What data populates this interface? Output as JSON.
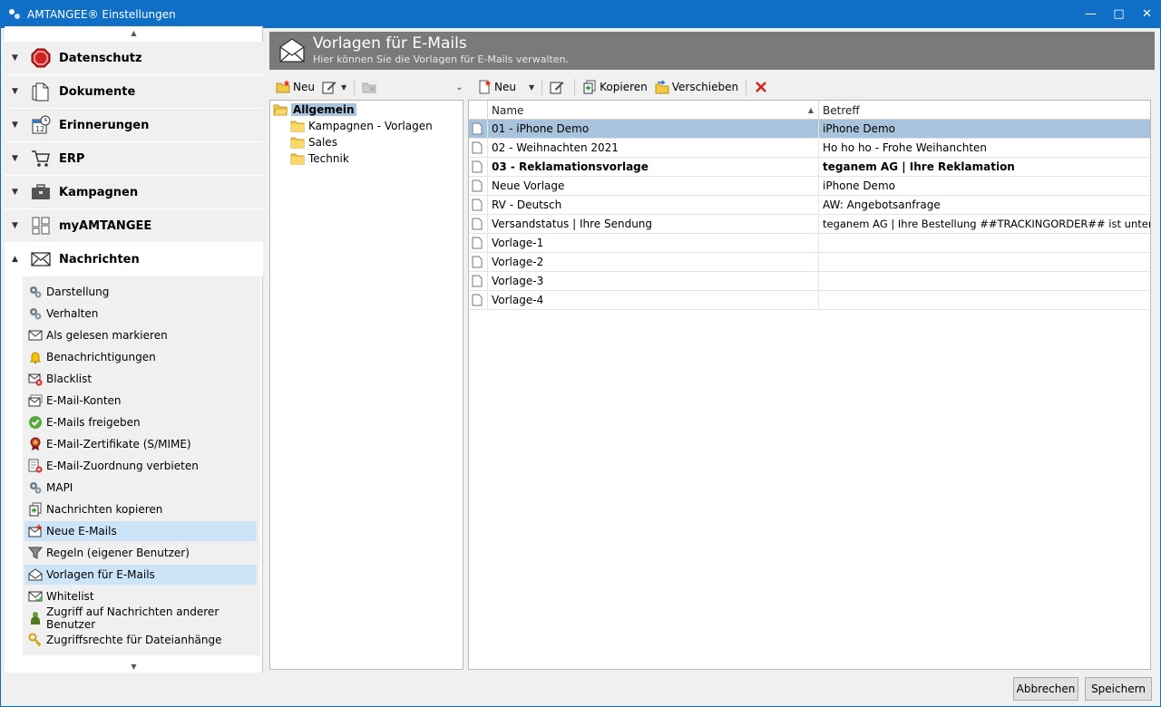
{
  "window": {
    "title": "AMTANGEE® Einstellungen"
  },
  "sidebar": {
    "categories": [
      {
        "label": "Datenschutz",
        "icon": "stop-sign-icon"
      },
      {
        "label": "Dokumente",
        "icon": "document-icon"
      },
      {
        "label": "Erinnerungen",
        "icon": "calendar-clock-icon"
      },
      {
        "label": "ERP",
        "icon": "cart-icon"
      },
      {
        "label": "Kampagnen",
        "icon": "briefcase-icon"
      },
      {
        "label": "myAMTANGEE",
        "icon": "grid-icon"
      },
      {
        "label": "Nachrichten",
        "icon": "envelope-icon"
      }
    ],
    "sub_items": [
      {
        "label": "Darstellung",
        "icon": "gears-icon"
      },
      {
        "label": "Verhalten",
        "icon": "gears-icon"
      },
      {
        "label": "Als gelesen markieren",
        "icon": "envelope-icon"
      },
      {
        "label": "Benachrichtigungen",
        "icon": "bell-icon"
      },
      {
        "label": "Blacklist",
        "icon": "envelope-blocked-icon"
      },
      {
        "label": "E-Mail-Konten",
        "icon": "envelope-accounts-icon"
      },
      {
        "label": "E-Mails freigeben",
        "icon": "checkmark-icon"
      },
      {
        "label": "E-Mail-Zertifikate (S/MIME)",
        "icon": "certificate-icon"
      },
      {
        "label": "E-Mail-Zuordnung verbieten",
        "icon": "forbidden-assign-icon"
      },
      {
        "label": "MAPI",
        "icon": "gears-icon"
      },
      {
        "label": "Nachrichten kopieren",
        "icon": "copy-icon"
      },
      {
        "label": "Neue E-Mails",
        "icon": "new-mail-icon"
      },
      {
        "label": "Regeln (eigener Benutzer)",
        "icon": "filter-icon"
      },
      {
        "label": "Vorlagen für E-Mails",
        "icon": "open-envelope-icon"
      },
      {
        "label": "Whitelist",
        "icon": "envelope-check-icon"
      },
      {
        "label": "Zugriff auf Nachrichten anderer Benutzer",
        "icon": "user-icon"
      },
      {
        "label": "Zugriffsrechte für Dateianhänge",
        "icon": "key-icon"
      }
    ]
  },
  "header": {
    "title": "Vorlagen für E-Mails",
    "subtitle": "Hier können Sie die Vorlagen für E-Mails verwalten."
  },
  "left_toolbar": {
    "new_label": "Neu"
  },
  "right_toolbar": {
    "new_label": "Neu",
    "copy_label": "Kopieren",
    "move_label": "Verschieben"
  },
  "tree": {
    "root": "Allgemein",
    "children": [
      "Kampagnen - Vorlagen",
      "Sales",
      "Technik"
    ]
  },
  "grid": {
    "columns": [
      "Name",
      "Betreff"
    ],
    "rows": [
      {
        "name": "01 - iPhone Demo",
        "subject": "iPhone Demo"
      },
      {
        "name": "02 - Weihnachten 2021",
        "subject": "Ho ho ho - Frohe Weihanchten"
      },
      {
        "name": "03 - Reklamationsvorlage",
        "subject": "teganem AG | Ihre Reklamation"
      },
      {
        "name": "Neue Vorlage",
        "subject": "iPhone Demo"
      },
      {
        "name": "RV - Deutsch",
        "subject": "AW: Angebotsanfrage"
      },
      {
        "name": "Versandstatus | Ihre Sendung",
        "subject": "teganem AG |  Ihre Bestellung ##TRACKINGORDER## ist unterwegs!"
      },
      {
        "name": "Vorlage-1",
        "subject": ""
      },
      {
        "name": "Vorlage-2",
        "subject": ""
      },
      {
        "name": "Vorlage-3",
        "subject": ""
      },
      {
        "name": "Vorlage-4",
        "subject": ""
      }
    ]
  },
  "footer": {
    "cancel_label": "Abbrechen",
    "save_label": "Speichern"
  },
  "colors": {
    "titlebar": "#0f6fc6",
    "selection": "#cce4f7",
    "header_band": "#7a7a7a"
  }
}
